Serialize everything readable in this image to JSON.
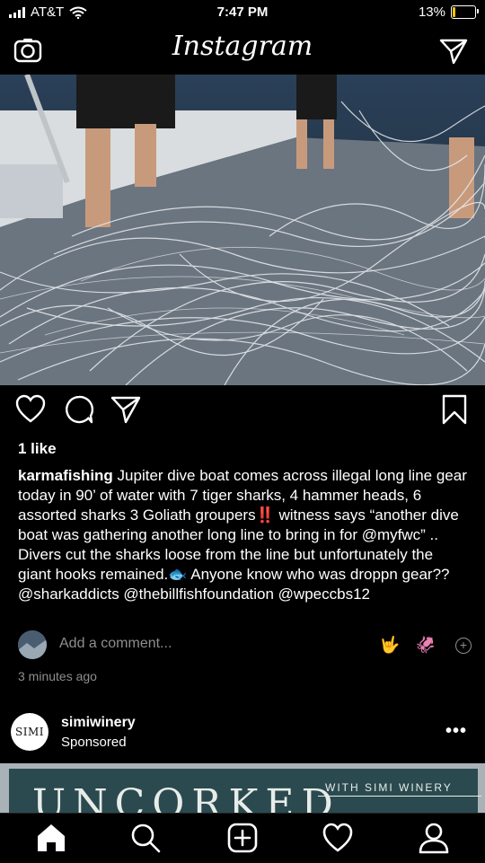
{
  "status_bar": {
    "carrier": "AT&T",
    "time": "7:47 PM",
    "battery": "13%",
    "battery_level": 0.13
  },
  "header": {
    "title": "Instagram"
  },
  "post": {
    "likes": "1 like",
    "caption": {
      "username": "karmafishing",
      "text_before_emoji1": " Jupiter dive boat comes across illegal long line gear today in 90’ of water with 7 tiger sharks, 4 hammer heads, 6 assorted sharks 3 Goliath groupers",
      "emoji1": "‼️",
      "text_between": " witness says “another dive boat was gathering another long line to bring in for @myfwc” .. Divers cut the sharks loose from the line but unfortunately the giant hooks remained.",
      "emoji2": "🐟",
      "text_after": " Anyone know who was droppn gear?? @sharkaddicts @thebillfishfoundation @wpeccbs12"
    },
    "comment": {
      "placeholder": "Add a comment...",
      "emoji_a": "🤟",
      "emoji_b": "🦑"
    },
    "timestamp": "3 minutes ago"
  },
  "sponsored": {
    "avatar_text": "SIMI",
    "username": "simiwinery",
    "label": "Sponsored",
    "more": "•••",
    "ad_big_text": "UNCORKED",
    "ad_small_text": "WITH SIMI WINERY"
  },
  "colors": {
    "muted": "#8e8e8e",
    "emoji_red": "#e0245e",
    "battery_fill": "#f5c400"
  },
  "icons": {
    "camera": "camera-icon",
    "direct": "paper-plane-icon",
    "heart": "heart-icon",
    "comment": "comment-icon",
    "share": "paper-plane-icon",
    "save": "bookmark-icon",
    "home": "home-icon",
    "search": "search-icon",
    "add": "add-post-icon",
    "activity": "heart-icon",
    "profile": "profile-icon"
  }
}
